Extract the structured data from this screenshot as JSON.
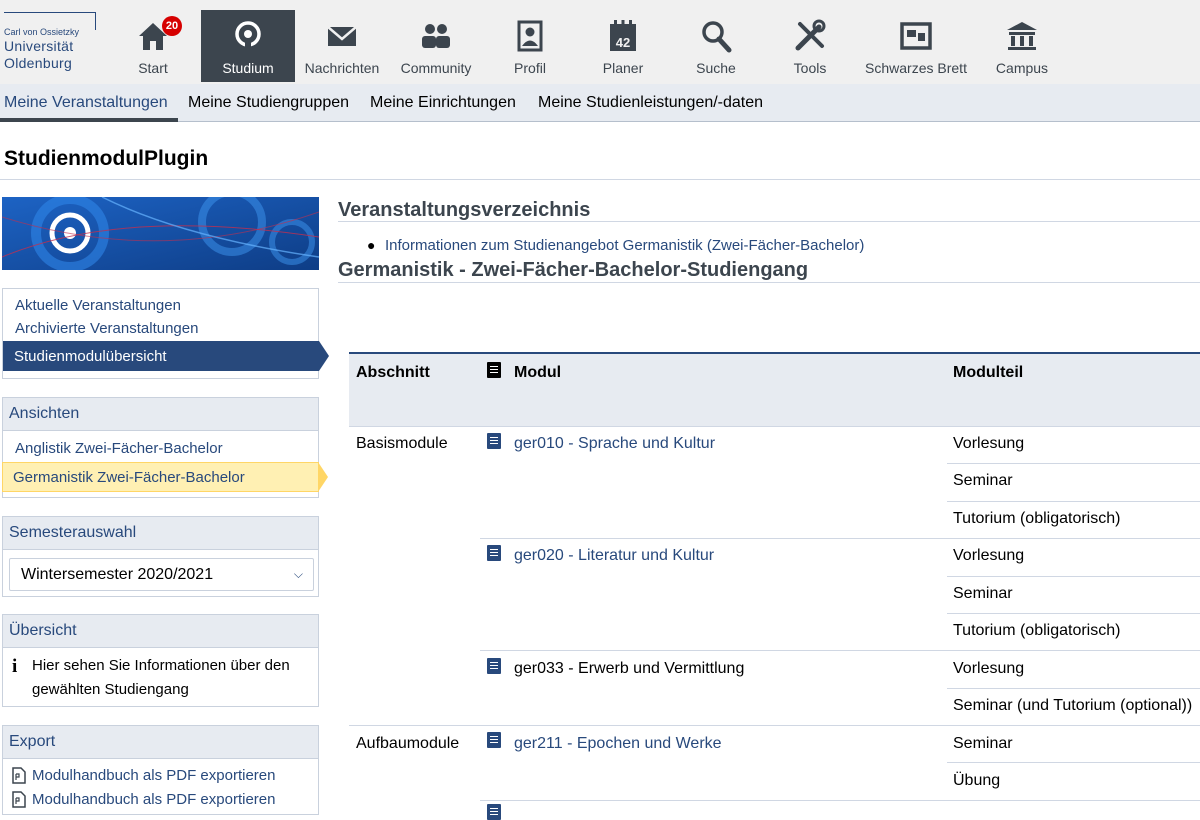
{
  "logo": {
    "line1": "Carl von Ossietzky",
    "line2": "Universität",
    "line3": "Oldenburg"
  },
  "nav": {
    "badge": "20",
    "items": [
      {
        "label": "Start"
      },
      {
        "label": "Studium"
      },
      {
        "label": "Nachrichten"
      },
      {
        "label": "Community"
      },
      {
        "label": "Profil"
      },
      {
        "label": "Planer"
      },
      {
        "label": "Suche"
      },
      {
        "label": "Tools"
      },
      {
        "label": "Schwarzes Brett"
      },
      {
        "label": "Campus"
      }
    ],
    "planer_day": "42"
  },
  "subnav": [
    "Meine Veranstaltungen",
    "Meine Studiengruppen",
    "Meine Einrichtungen",
    "Meine Studienleistungen/-daten"
  ],
  "page_title": "StudienmodulPlugin",
  "sidebar": {
    "links": [
      "Aktuelle Veranstaltungen",
      "Archivierte Veranstaltungen",
      "Studienmodulübersicht"
    ],
    "ansichten": {
      "title": "Ansichten",
      "items": [
        "Anglistik Zwei-Fächer-Bachelor",
        "Germanistik Zwei-Fächer-Bachelor"
      ]
    },
    "semester": {
      "title": "Semesterauswahl",
      "value": "Wintersemester 2020/2021"
    },
    "uebersicht": {
      "title": "Übersicht",
      "text1": "Hier sehen Sie Informationen über den",
      "text2": "gewählten Studiengang"
    },
    "export": {
      "title": "Export",
      "items": [
        "Modulhandbuch als PDF exportieren",
        "Modulhandbuch als PDF exportieren"
      ]
    }
  },
  "main": {
    "heading1": "Veranstaltungsverzeichnis",
    "info_link": "Informationen zum Studienangebot Germanistik (Zwei-Fächer-Bachelor)",
    "heading2": "Germanistik - Zwei-Fächer-Bachelor-Studiengang",
    "table": {
      "headers": {
        "abschnitt": "Abschnitt",
        "modul": "Modul",
        "modulteil": "Modulteil"
      },
      "abschnitte": [
        "Basismodule",
        "Aufbaumodule"
      ],
      "module": [
        "ger010 - Sprache und Kultur",
        "ger020 - Literatur und Kultur",
        "ger033 - Erwerb und Vermittlung",
        "ger211 - Epochen und Werke"
      ],
      "modulteile": [
        "Vorlesung",
        "Seminar",
        "Tutorium (obligatorisch)",
        "Vorlesung",
        "Seminar",
        "Tutorium (obligatorisch)",
        "Vorlesung",
        "Seminar (und Tutorium (optional))",
        "Seminar",
        "Übung"
      ]
    }
  },
  "colors": {
    "brand_blue": "#28497c",
    "nav_active": "#3c454e",
    "highlight_yellow": "#fff0b3",
    "badge_red": "#d60000"
  }
}
